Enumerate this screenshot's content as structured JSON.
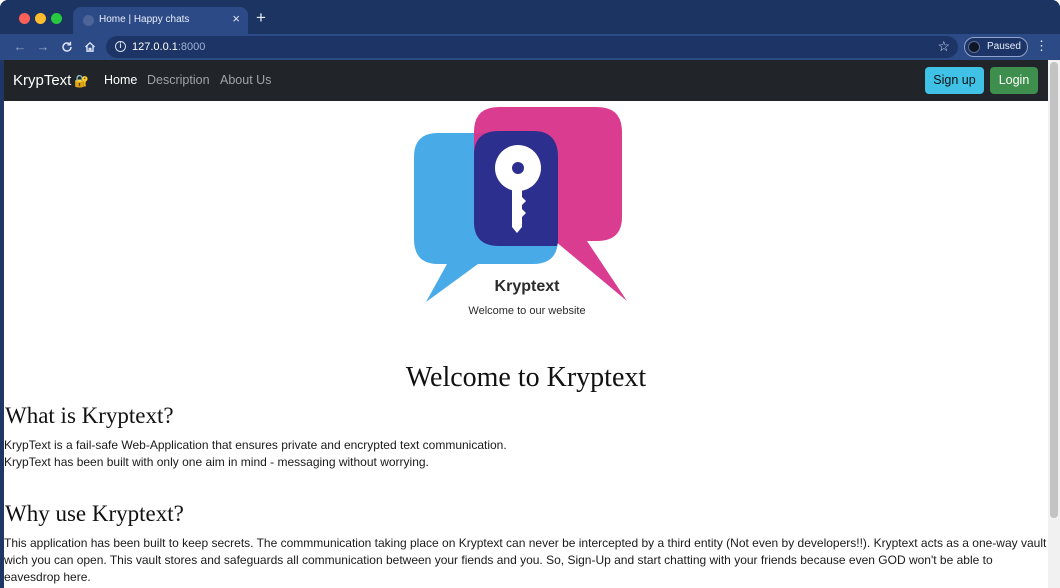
{
  "browser": {
    "tab_title": "Home | Happy chats",
    "url_host": "127.0.0.1",
    "url_port": ":8000",
    "profile_label": "Paused"
  },
  "navbar": {
    "brand": "KrypText",
    "brand_icon": "🔐",
    "links": [
      "Home",
      "Description",
      "About Us"
    ],
    "signup_label": "Sign up",
    "login_label": "Login"
  },
  "logo": {
    "name": "Kryptext",
    "tagline": "Welcome to our website",
    "colors": {
      "blue": "#3fa5e7",
      "pink": "#d8338a",
      "overlap": "#2c2f8e"
    }
  },
  "main": {
    "welcome_heading": "Welcome to Kryptext",
    "what_heading": "What is Kryptext?",
    "what_paragraphs": [
      "KrypText is a fail-safe Web-Application that ensures private and encrypted text communication.",
      "KrypText has been built with only one aim in mind - messaging without worrying."
    ],
    "why_heading": "Why use Kryptext?",
    "why_paragraph": "This application has been built to keep secrets. The commmunication taking place on Kryptext can never be intercepted by a third entity (Not even by developers!!). Kryptext acts as a one-way vault wich you can open. This vault stores and safeguards all communication between your fiends and you. So, Sign-Up and start chatting with your friends because even GOD won't be able to eavesdrop here."
  },
  "colors": {
    "navbar_bg": "#212529",
    "signup_bg": "#3fc2e6",
    "login_bg": "#3e8e4e",
    "browser_frame": "#1c3461"
  }
}
